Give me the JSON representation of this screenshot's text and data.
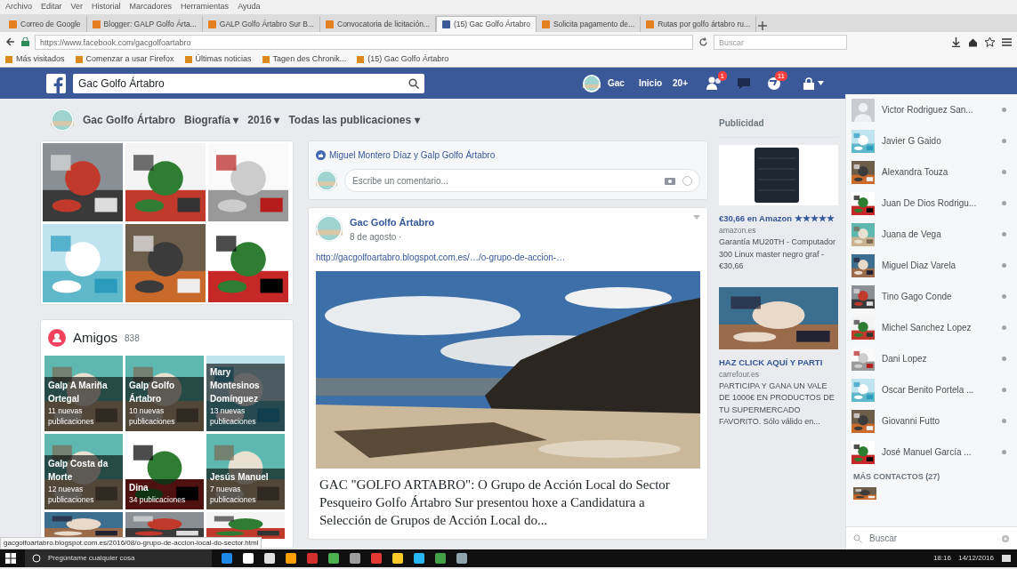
{
  "browser": {
    "menu": [
      "Archivo",
      "Editar",
      "Ver",
      "Historial",
      "Marcadores",
      "Herramientas",
      "Ayuda"
    ],
    "tabs": [
      {
        "title": "Correo de Google",
        "selected": false
      },
      {
        "title": "Blogger: GALP Golfo Árta...",
        "selected": false
      },
      {
        "title": "GALP Golfo Ártabro Sur B...",
        "selected": false
      },
      {
        "title": "Convocatoria de licitación...",
        "selected": false
      },
      {
        "title": "(15) Gac Golfo Ártabro",
        "selected": true
      },
      {
        "title": "Solicita pagamento de...",
        "selected": false
      },
      {
        "title": "Rutas por golfo ártabro ru...",
        "selected": false
      }
    ],
    "address": "https://www.facebook.com/gacgolfoartabro",
    "search_placeholder": "Buscar",
    "bookmarks": [
      "Más visitados",
      "Comenzar a usar Firefox",
      "Últimas noticias",
      "Tagen des Chronik...",
      "(15) Gac Golfo Ártabro"
    ]
  },
  "header": {
    "search_value": "Gac Golfo Ártabro",
    "profile": "Gac",
    "home": "Inicio",
    "home_count": "20+",
    "badges": [
      "1",
      "11"
    ]
  },
  "subnav": {
    "page": "Gac Golfo Ártabro",
    "items": [
      "Biografía ▾",
      "2016 ▾",
      "Todas las publicaciones ▾"
    ]
  },
  "friends": {
    "title": "Amigos",
    "count": "838",
    "tiles": [
      {
        "name": "Galp A Mariña Ortegal",
        "posts": "11 nuevas publicaciones"
      },
      {
        "name": "Galp Golfo Ártabro",
        "posts": "10 nuevas publicaciones"
      },
      {
        "name": "Mary Montesinos Domínguez",
        "posts": "13 nuevas publicaciones"
      },
      {
        "name": "Galp Costa da Morte",
        "posts": "12 nuevas publicaciones"
      },
      {
        "name": "Dina",
        "posts": "34 publicaciones"
      },
      {
        "name": "Jesús Manuel",
        "posts": "7 nuevas publicaciones"
      }
    ]
  },
  "comment_box": {
    "reactions": "Miguel Montero Díaz y Galp Golfo Ártabro",
    "placeholder": "Escribe un comentario..."
  },
  "post": {
    "author": "Gac Golfo Ártabro",
    "date": "8 de agosto ·",
    "link": "http://gacgolfoartabro.blogspot.com.es/…/o-grupo-de-accion-…",
    "title": "GAC \"GOLFO ARTABRO\": O Grupo de Acción Local do Sector Pesqueiro Golfo Ártabro Sur presentou hoxe a Candidatura a Selección de Grupos de Acción Local do..."
  },
  "ads": {
    "title": "Publicidad",
    "items": [
      {
        "headline": "€30,66 en Amazon ★★★★★",
        "domain": "amazon.es",
        "text": "Garantía MU20TH - Computador 300 Linux master negro graf - €30,66"
      },
      {
        "headline": "HAZ CLICK AQUÍ Y PARTI",
        "domain": "carrefour.es",
        "text": "PARTICIPA Y GANA UN VALE DE 1000€ EN PRODUCTOS DE TU SUPERMERCADO FAVORITO. Sólo válido en..."
      }
    ]
  },
  "contacts": {
    "items": [
      "Victor Rodriguez San...",
      "Javier G Gaido",
      "Alexandra Touza",
      "Juan De Dios Rodrigu...",
      "Juana de Vega",
      "Miguel Diaz Varela",
      "Tino Gago Conde",
      "Michel Sanchez Lopez",
      "Dani Lopez",
      "Oscar Benito Portela ...",
      "Giovanni Futto",
      "José Manuel García ..."
    ],
    "more": "MÁS CONTACTOS (27)",
    "search_placeholder": "Buscar"
  },
  "status_url": "gacgolfoartabro.blogspot.com.es/2016/08/o-grupo-de-accion-local-do-sector.html",
  "taskbar": {
    "search_placeholder": "Pregúntame cualquier cosa",
    "time": "18:16",
    "date": "14/12/2016"
  }
}
